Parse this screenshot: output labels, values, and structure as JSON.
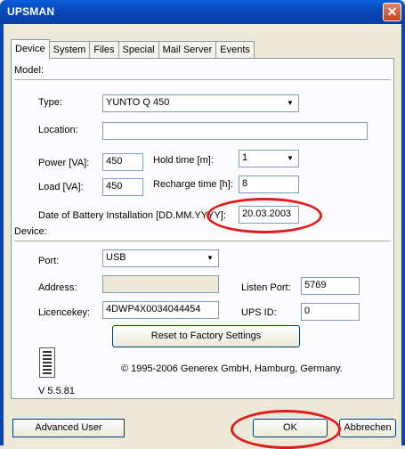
{
  "window": {
    "title": "UPSMAN",
    "close_glyph": "✕"
  },
  "tabs": [
    "Device",
    "System",
    "Files",
    "Special",
    "Mail Server",
    "Events"
  ],
  "model": {
    "heading": "Model:",
    "type_label": "Type:",
    "type_value": "YUNTO Q 450",
    "location_label": "Location:",
    "location_value": "",
    "power_label": "Power [VA]:",
    "power_value": "450",
    "hold_label": "Hold time [m]:",
    "hold_value": "1",
    "load_label": "Load [VA]:",
    "load_value": "450",
    "recharge_label": "Recharge time [h]:",
    "recharge_value": "8",
    "battery_label": "Date of Battery Installation [DD.MM.YYYY]:",
    "battery_value": "20.03.2003"
  },
  "device": {
    "heading": "Device:",
    "port_label": "Port:",
    "port_value": "USB",
    "address_label": "Address:",
    "address_value": "",
    "listen_label": "Listen Port:",
    "listen_value": "5769",
    "licence_label": "Licencekey:",
    "licence_value": "4DWP4X0034044454",
    "upsid_label": "UPS ID:",
    "upsid_value": "0",
    "reset_label": "Reset to Factory Settings"
  },
  "footer": {
    "copyright": "© 1995-2006 Generex GmbH, Hamburg, Germany.",
    "version": "V 5.5.81"
  },
  "buttons": {
    "advanced": "Advanced User",
    "ok": "OK",
    "cancel": "Abbrechen"
  },
  "colors": {
    "title_bar": "#0a5fd8",
    "annotation": "#e31a1a",
    "dialog_bg": "#ece9d8"
  }
}
